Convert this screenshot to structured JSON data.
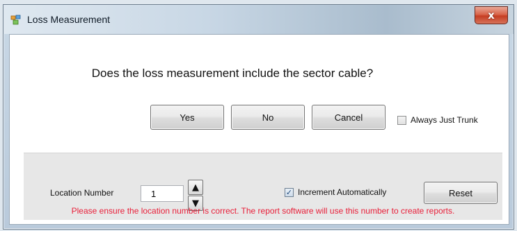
{
  "window": {
    "title": "Loss Measurement",
    "close_glyph": "x"
  },
  "dialog": {
    "question": "Does the loss measurement include the sector cable?",
    "buttons": {
      "yes": "Yes",
      "no": "No",
      "cancel": "Cancel"
    },
    "always_just_trunk": {
      "label": "Always Just Trunk",
      "checked": false
    }
  },
  "panel": {
    "location_label": "Location Number",
    "location_value": "1",
    "spin_up_glyph": "▲",
    "spin_down_glyph": "▼",
    "increment_auto": {
      "label": "Increment Automatically",
      "checked": true,
      "check_glyph": "✓"
    },
    "reset_label": "Reset",
    "warning": "Please ensure the location number is correct.  The report software will use this number to create reports."
  },
  "colors": {
    "warning_text": "#e8203a",
    "close_button": "#c53d22",
    "panel_background": "#e7e7e7"
  },
  "icons": {
    "app_icon": "app-window-icon",
    "close_icon": "close-icon",
    "spin_up": "arrow-up-icon",
    "spin_down": "arrow-down-icon"
  }
}
